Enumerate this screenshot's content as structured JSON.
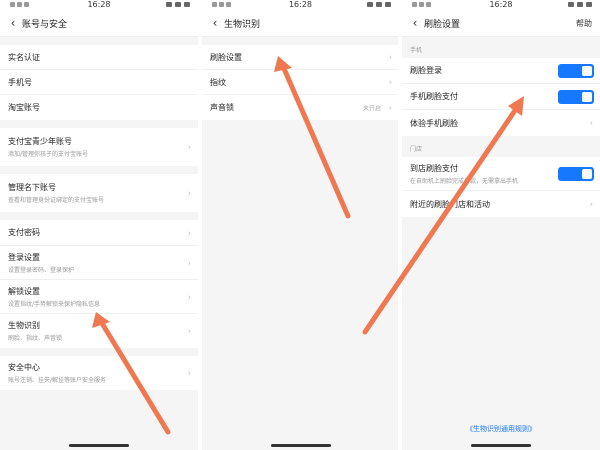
{
  "status_bar": {
    "time": "16:28"
  },
  "colors": {
    "toggle_on": "#1677ff",
    "arrow": "#f07850",
    "link": "#1677ff"
  },
  "screen1": {
    "title": "账号与安全",
    "back_icon": "back-arrow-icon",
    "items": [
      {
        "title": "实名认证"
      },
      {
        "title": "手机号"
      },
      {
        "title": "淘宝账号"
      },
      {
        "title": "支付宝青少年账号",
        "sub": "添加/管理你孩子的支付宝账号"
      },
      {
        "title": "管理名下账号",
        "sub": "查看和管理身份证绑定的支付宝账号"
      },
      {
        "title": "支付密码"
      },
      {
        "title": "登录设置",
        "sub": "设置登录密码、登录保护"
      },
      {
        "title": "解锁设置",
        "sub": "设置指纹/手势解锁来保护隐私信息"
      },
      {
        "title": "生物识别",
        "sub": "刷脸、指纹、声音锁"
      },
      {
        "title": "安全中心",
        "sub": "账号注销、挂失/解挂等账户安全服务"
      }
    ]
  },
  "screen2": {
    "title": "生物识别",
    "items": [
      {
        "title": "刷脸设置"
      },
      {
        "title": "指纹"
      },
      {
        "title": "声音锁",
        "status": "未开启"
      }
    ]
  },
  "screen3": {
    "title": "刷脸设置",
    "help": "帮助",
    "phone_section": "手机",
    "phone_items": [
      {
        "title": "刷脸登录",
        "toggle": "on"
      },
      {
        "title": "手机刷脸支付",
        "toggle": "on"
      },
      {
        "title": "体验手机刷脸"
      }
    ],
    "store_section": "门店",
    "store_items": [
      {
        "title": "到店刷脸支付",
        "sub": "在自助机上刷脸完成付款，无需拿出手机",
        "toggle": "on"
      },
      {
        "title": "附近的刷脸门店和活动"
      }
    ],
    "footer_link": "《生物识别通用规则》"
  }
}
